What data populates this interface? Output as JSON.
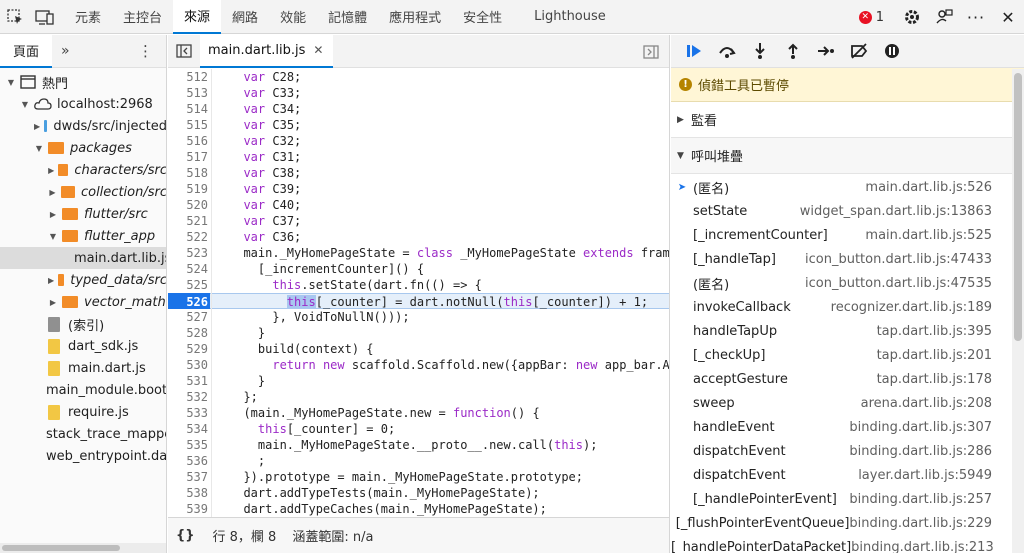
{
  "topbar": {
    "tabs": [
      "元素",
      "主控台",
      "來源",
      "網路",
      "效能",
      "記憶體",
      "應用程式",
      "安全性",
      "Lighthouse"
    ],
    "active_tab": "來源",
    "error_count": "1"
  },
  "left_panel": {
    "tab_label": "頁面",
    "more_label": "»",
    "tree": [
      {
        "label": "熱門",
        "indent": 0,
        "arrow": "▼",
        "icon": "window-icon",
        "italic": false
      },
      {
        "label": "localhost:2968",
        "indent": 1,
        "arrow": "▼",
        "icon": "cloud-icon",
        "italic": false
      },
      {
        "label": "dwds/src/injected",
        "indent": 2,
        "arrow": "▶",
        "icon": "folder-blue",
        "italic": false
      },
      {
        "label": "packages",
        "indent": 2,
        "arrow": "▼",
        "icon": "folder-orange",
        "italic": true
      },
      {
        "label": "characters/src",
        "indent": 3,
        "arrow": "▶",
        "icon": "folder-orange",
        "italic": true
      },
      {
        "label": "collection/src",
        "indent": 3,
        "arrow": "▶",
        "icon": "folder-orange",
        "italic": true
      },
      {
        "label": "flutter/src",
        "indent": 3,
        "arrow": "▶",
        "icon": "folder-orange",
        "italic": true
      },
      {
        "label": "flutter_app",
        "indent": 3,
        "arrow": "▼",
        "icon": "folder-orange",
        "italic": true
      },
      {
        "label": "main.dart.lib.js",
        "indent": 4,
        "arrow": "",
        "icon": "file-yellow",
        "italic": false,
        "selected": true
      },
      {
        "label": "typed_data/src",
        "indent": 3,
        "arrow": "▶",
        "icon": "folder-orange",
        "italic": true
      },
      {
        "label": "vector_math",
        "indent": 3,
        "arrow": "▶",
        "icon": "folder-orange",
        "italic": true
      },
      {
        "label": "(索引)",
        "indent": 2,
        "arrow": "",
        "icon": "file-grey",
        "italic": false
      },
      {
        "label": "dart_sdk.js",
        "indent": 2,
        "arrow": "",
        "icon": "file-yellow",
        "italic": false
      },
      {
        "label": "main.dart.js",
        "indent": 2,
        "arrow": "",
        "icon": "file-yellow",
        "italic": false
      },
      {
        "label": "main_module.bootstrap.js",
        "indent": 2,
        "arrow": "",
        "icon": "file-yellow",
        "italic": false
      },
      {
        "label": "require.js",
        "indent": 2,
        "arrow": "",
        "icon": "file-yellow",
        "italic": false
      },
      {
        "label": "stack_trace_mapper.js",
        "indent": 2,
        "arrow": "",
        "icon": "file-yellow",
        "italic": false
      },
      {
        "label": "web_entrypoint.dart.js",
        "indent": 2,
        "arrow": "",
        "icon": "file-yellow",
        "italic": false
      }
    ]
  },
  "editor": {
    "file_tab": "main.dart.lib.js",
    "breakpoint_line": "526",
    "lines": [
      {
        "n": "512",
        "html": "  <span class=\"kw\">var</span> C28;"
      },
      {
        "n": "513",
        "html": "  <span class=\"kw\">var</span> C33;"
      },
      {
        "n": "514",
        "html": "  <span class=\"kw\">var</span> C34;"
      },
      {
        "n": "515",
        "html": "  <span class=\"kw\">var</span> C35;"
      },
      {
        "n": "516",
        "html": "  <span class=\"kw\">var</span> C32;"
      },
      {
        "n": "517",
        "html": "  <span class=\"kw\">var</span> C31;"
      },
      {
        "n": "518",
        "html": "  <span class=\"kw\">var</span> C38;"
      },
      {
        "n": "519",
        "html": "  <span class=\"kw\">var</span> C39;"
      },
      {
        "n": "520",
        "html": "  <span class=\"kw\">var</span> C40;"
      },
      {
        "n": "521",
        "html": "  <span class=\"kw\">var</span> C37;"
      },
      {
        "n": "522",
        "html": "  <span class=\"kw\">var</span> C36;"
      },
      {
        "n": "523",
        "html": "  main._MyHomePageState = <span class=\"kw\">class</span> _MyHomePageState <span class=\"kw\">extends</span> framework.State$(main.MyHomePage) {"
      },
      {
        "n": "524",
        "html": "    [_incrementCounter]() {"
      },
      {
        "n": "525",
        "html": "      <span class=\"kw\">this</span>.setState(dart.fn(() => {"
      },
      {
        "n": "526",
        "html": "        <span class=\"hl\"><span class=\"kw\">this</span></span>[_counter] = dart.notNull(<span class=\"kw\">this</span>[_counter]) + 1;"
      },
      {
        "n": "527",
        "html": "      }, VoidToNullN()));"
      },
      {
        "n": "528",
        "html": "    }"
      },
      {
        "n": "529",
        "html": "    build(context) {"
      },
      {
        "n": "530",
        "html": "      <span class=\"kw\">return</span> <span class=\"kw\">new</span> scaffold.Scaffold.new({appBar: <span class=\"kw\">new</span> app_bar.AppBar.new({"
      },
      {
        "n": "531",
        "html": "    }"
      },
      {
        "n": "532",
        "html": "  };"
      },
      {
        "n": "533",
        "html": "  (main._MyHomePageState.new = <span class=\"kw\">function</span>() {"
      },
      {
        "n": "534",
        "html": "    <span class=\"kw\">this</span>[_counter] = 0;"
      },
      {
        "n": "535",
        "html": "    main._MyHomePageState.__proto__.new.call(<span class=\"kw\">this</span>);"
      },
      {
        "n": "536",
        "html": "    ;"
      },
      {
        "n": "537",
        "html": "  }).prototype = main._MyHomePageState.prototype;"
      },
      {
        "n": "538",
        "html": "  dart.addTypeTests(main._MyHomePageState);"
      },
      {
        "n": "539",
        "html": "  dart.addTypeCaches(main._MyHomePageState);"
      },
      {
        "n": "540",
        "html": ""
      }
    ],
    "status": {
      "brace": "{}",
      "position": "行 8，欄 8",
      "coverage": "涵蓋範圍: n/a"
    }
  },
  "debugger": {
    "paused_message": "偵錯工具已暫停",
    "watch_label": "監看",
    "callstack_label": "呼叫堆疊",
    "frames": [
      {
        "name": "(匿名)",
        "location": "main.dart.lib.js:526",
        "current": true
      },
      {
        "name": "setState",
        "location": "widget_span.dart.lib.js:13863"
      },
      {
        "name": "[_incrementCounter]",
        "location": "main.dart.lib.js:525"
      },
      {
        "name": "[_handleTap]",
        "location": "icon_button.dart.lib.js:47433"
      },
      {
        "name": "(匿名)",
        "location": "icon_button.dart.lib.js:47535"
      },
      {
        "name": "invokeCallback",
        "location": "recognizer.dart.lib.js:189"
      },
      {
        "name": "handleTapUp",
        "location": "tap.dart.lib.js:395"
      },
      {
        "name": "[_checkUp]",
        "location": "tap.dart.lib.js:201"
      },
      {
        "name": "acceptGesture",
        "location": "tap.dart.lib.js:178"
      },
      {
        "name": "sweep",
        "location": "arena.dart.lib.js:208"
      },
      {
        "name": "handleEvent",
        "location": "binding.dart.lib.js:307"
      },
      {
        "name": "dispatchEvent",
        "location": "binding.dart.lib.js:286"
      },
      {
        "name": "dispatchEvent",
        "location": "layer.dart.lib.js:5949"
      },
      {
        "name": "[_handlePointerEvent]",
        "location": "binding.dart.lib.js:257"
      },
      {
        "name": "[_flushPointerEventQueue]",
        "location": "binding.dart.lib.js:229"
      },
      {
        "name": "[_handlePointerDataPacket]",
        "location": "binding.dart.lib.js:213"
      }
    ]
  }
}
